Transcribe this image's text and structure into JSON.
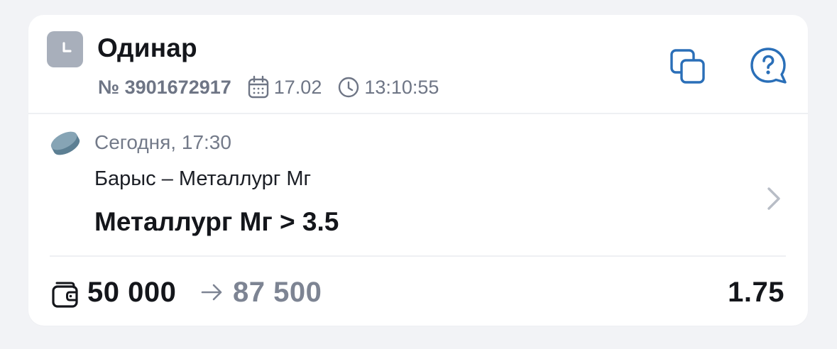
{
  "bet": {
    "type_title": "Одинар",
    "number": "№ 3901672917",
    "date": "17.02",
    "time": "13:10:55",
    "status_icon": "clock-icon"
  },
  "actions": {
    "copy_icon": "copy-icon",
    "help_icon": "help-bubble-icon"
  },
  "event": {
    "sport_icon": "hockey-puck-icon",
    "start": "Сегодня, 17:30",
    "teams": "Барыс – Металлург Мг",
    "market": "Металлург Мг > 3.5"
  },
  "footer": {
    "stake": "50 000",
    "payout": "87 500",
    "odds": "1.75"
  },
  "colors": {
    "accent": "#2A6FB8",
    "status_tile": "#A8AFBB",
    "puck": "#6B8FA3"
  }
}
